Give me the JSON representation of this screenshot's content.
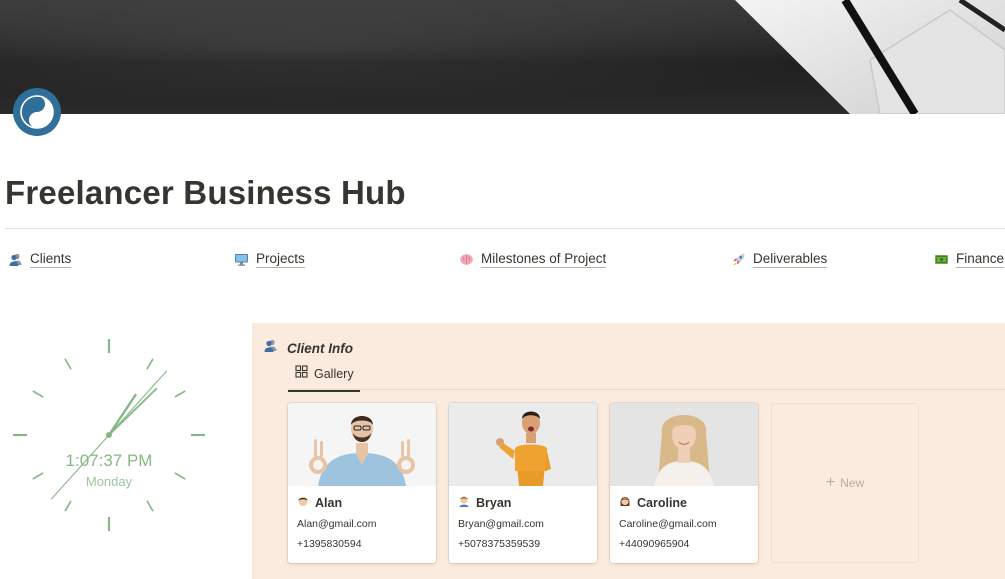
{
  "page": {
    "title": "Freelancer Business Hub",
    "icon": "yin-yang-icon",
    "cover": "dark-desk-photo"
  },
  "nav": {
    "links": [
      {
        "label": "Clients",
        "icon": "busts-icon"
      },
      {
        "label": "Projects",
        "icon": "computer-icon"
      },
      {
        "label": "Milestones of Project",
        "icon": "brain-icon"
      },
      {
        "label": "Deliverables",
        "icon": "rocket-icon"
      },
      {
        "label": "Finance",
        "icon": "money-icon"
      }
    ]
  },
  "clock": {
    "time": "1:07:37 PM",
    "day": "Monday",
    "color": "#86b886"
  },
  "database": {
    "title": "Client Info",
    "view_label": "Gallery",
    "background": "#fbebde",
    "cards": [
      {
        "name": "Alan",
        "email": "Alan@gmail.com",
        "phone": "+1395830594"
      },
      {
        "name": "Bryan",
        "email": "Bryan@gmail.com",
        "phone": "+5078375359539"
      },
      {
        "name": "Caroline",
        "email": "Caroline@gmail.com",
        "phone": "+44090965904"
      }
    ],
    "new_label": "New"
  }
}
